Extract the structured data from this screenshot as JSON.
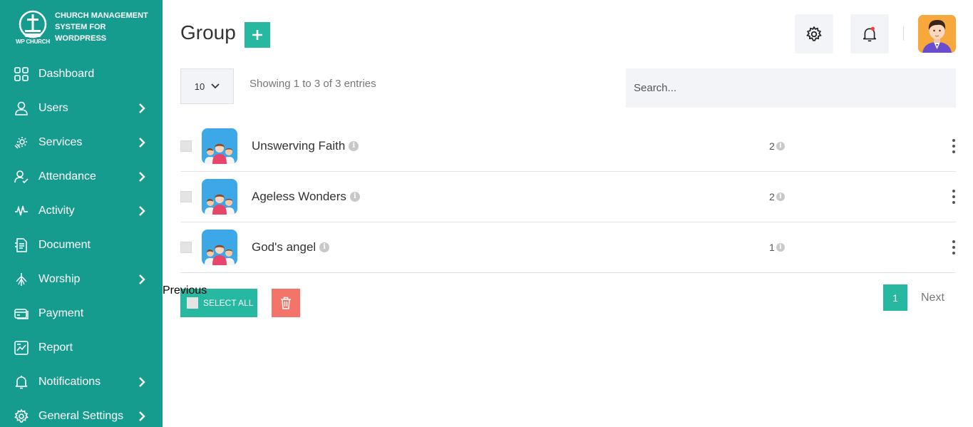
{
  "brand": {
    "short": "WP CHURCH",
    "line1": "CHURCH MANAGEMENT",
    "line2": "SYSTEM FOR",
    "line3": "WORDPRESS"
  },
  "sidebar": {
    "items": [
      {
        "label": "Dashboard",
        "icon": "dashboard-icon",
        "has_submenu": false
      },
      {
        "label": "Users",
        "icon": "user-icon",
        "has_submenu": true
      },
      {
        "label": "Services",
        "icon": "services-icon",
        "has_submenu": true
      },
      {
        "label": "Attendance",
        "icon": "attendance-icon",
        "has_submenu": true
      },
      {
        "label": "Activity",
        "icon": "activity-icon",
        "has_submenu": true
      },
      {
        "label": "Document",
        "icon": "document-icon",
        "has_submenu": false
      },
      {
        "label": "Worship",
        "icon": "worship-icon",
        "has_submenu": true
      },
      {
        "label": "Payment",
        "icon": "payment-icon",
        "has_submenu": false
      },
      {
        "label": "Report",
        "icon": "report-icon",
        "has_submenu": false
      },
      {
        "label": "Notifications",
        "icon": "bell-icon",
        "has_submenu": true
      },
      {
        "label": "General Settings",
        "icon": "gear-icon",
        "has_submenu": true
      }
    ]
  },
  "header": {
    "title": "Group",
    "add_label": "+"
  },
  "table": {
    "page_size": "10",
    "info": "Showing 1 to 3 of 3 entries",
    "search_placeholder": "Search...",
    "rows": [
      {
        "name": "Unswerving Faith",
        "count": "2"
      },
      {
        "name": "Ageless Wonders",
        "count": "2"
      },
      {
        "name": "God's angel",
        "count": "1"
      }
    ]
  },
  "actions": {
    "select_all": "SELECT ALL"
  },
  "pagination": {
    "previous": "Previous",
    "current": "1",
    "next": "Next"
  },
  "colors": {
    "sidebar": "#169c8f",
    "accent": "#26b8a0",
    "danger": "#f37468",
    "group_avatar": "#3da8e8",
    "notification_dot": "#f44336"
  }
}
